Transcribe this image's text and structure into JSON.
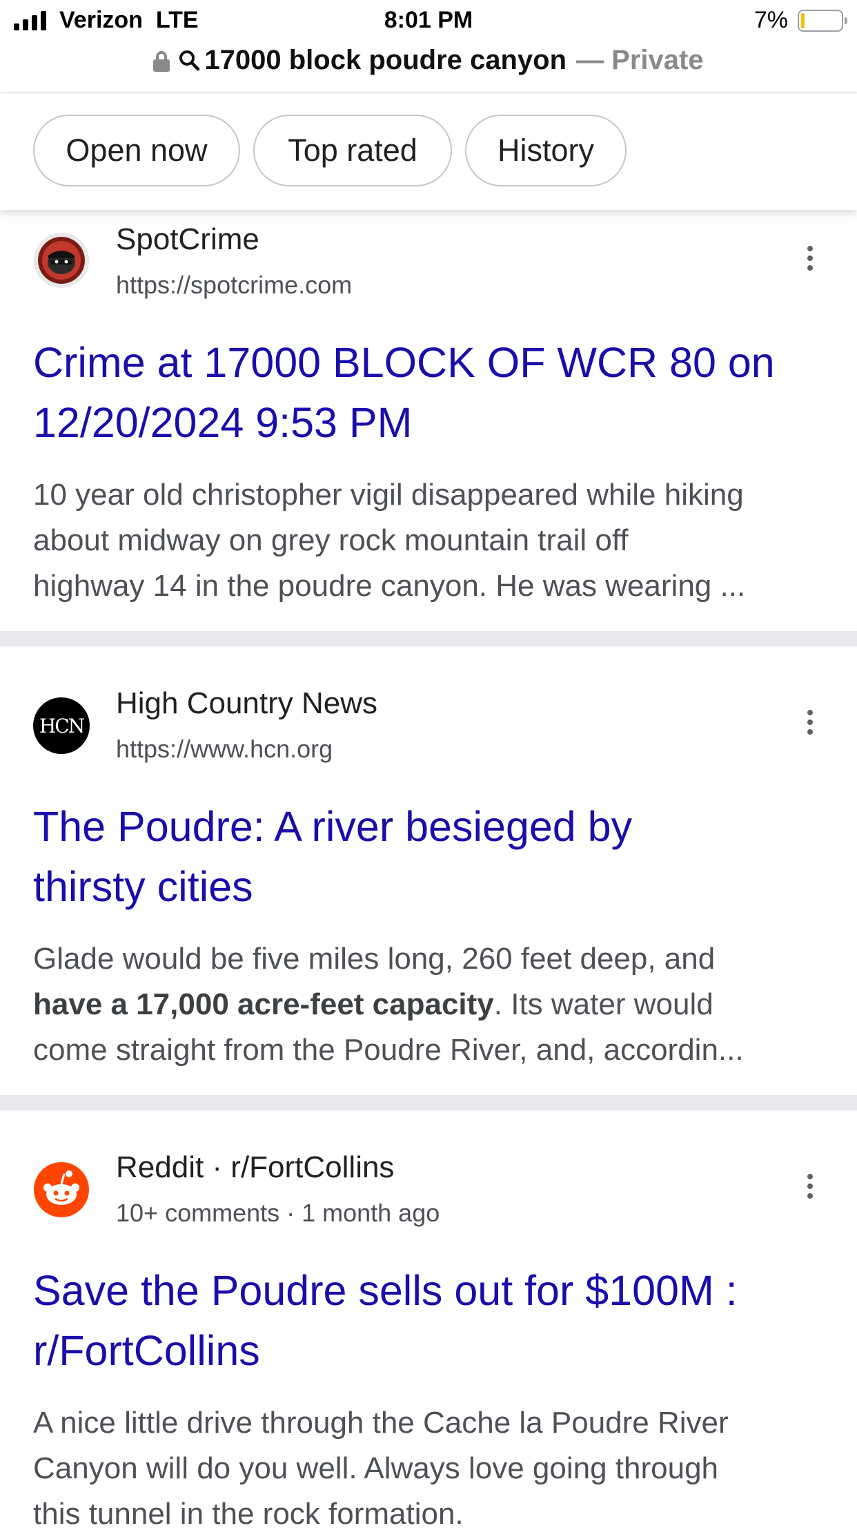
{
  "status": {
    "carrier": "Verizon  LTE",
    "time": "8:01 PM",
    "battery": "7%",
    "battery_level": 0.07
  },
  "urlbar": {
    "query": "17000 block poudre canyon",
    "private": "— Private"
  },
  "chips": [
    "Open now",
    "Top rated",
    "History"
  ],
  "results": [
    {
      "site": "SpotCrime",
      "url": "https://spotcrime.com",
      "title_lines": [
        "Crime at 17000 BLOCK OF WCR 80 on",
        "12/20/2024 9:53 PM"
      ],
      "snippet_lines": [
        "10 year old christopher vigil disappeared while hiking",
        "about midway on grey rock mountain trail off",
        "highway 14 in the poudre canyon. He was wearing ..."
      ]
    },
    {
      "site": "High Country News",
      "url": "https://www.hcn.org",
      "favicon_text": "HCN",
      "title_lines": [
        "The Poudre: A river besieged by",
        "thirsty cities"
      ],
      "snippet_line1": "Glade would be five miles long, 260 feet deep, and",
      "snippet_bold": "have a 17,000 acre-feet capacity",
      "snippet_after_bold": ". Its water would",
      "snippet_line3": "come straight from the Poudre River, and, accordin..."
    },
    {
      "site": "Reddit · r/FortCollins",
      "url": "10+ comments · 1 month ago",
      "title_lines": [
        "Save the Poudre sells out for $100M :",
        "r/FortCollins"
      ],
      "snippet_lines": [
        "A nice little drive through the Cache la Poudre River",
        "Canyon will do you well. Always love going through",
        "this tunnel in the rock formation."
      ]
    }
  ]
}
